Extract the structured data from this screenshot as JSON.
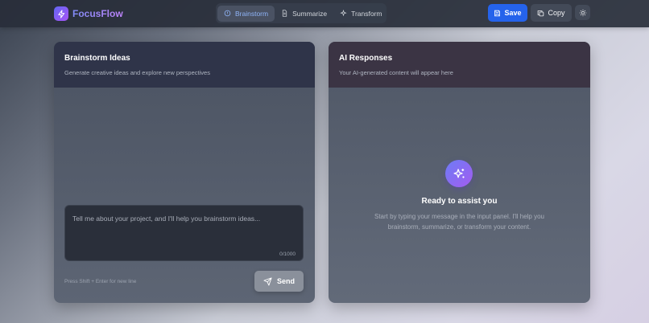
{
  "app": {
    "name": "FocusFlow",
    "logo_icon": "bolt-icon"
  },
  "tabs": [
    {
      "label": "Brainstorm",
      "icon": "lightbulb-icon",
      "active": true
    },
    {
      "label": "Summarize",
      "icon": "document-icon",
      "active": false
    },
    {
      "label": "Transform",
      "icon": "sparkle-icon",
      "active": false
    }
  ],
  "toolbar": {
    "save_label": "Save",
    "copy_label": "Copy",
    "theme_icon": "sun-icon"
  },
  "input_panel": {
    "title": "Brainstorm Ideas",
    "subtitle": "Generate creative ideas and explore new perspectives",
    "placeholder": "Tell me about your project, and I'll help you brainstorm ideas...",
    "counter": "0/1000",
    "hint": "Press Shift + Enter for new line",
    "send_label": "Send"
  },
  "output_panel": {
    "title": "AI Responses",
    "subtitle": "Your AI-generated content will appear here",
    "empty_title": "Ready to assist you",
    "empty_desc": "Start by typing your message in the input panel. I'll help you brainstorm, summarize, or transform your content."
  },
  "colors": {
    "accent": "#2563eb",
    "brand_start": "#6366f1",
    "brand_end": "#a855f7"
  }
}
